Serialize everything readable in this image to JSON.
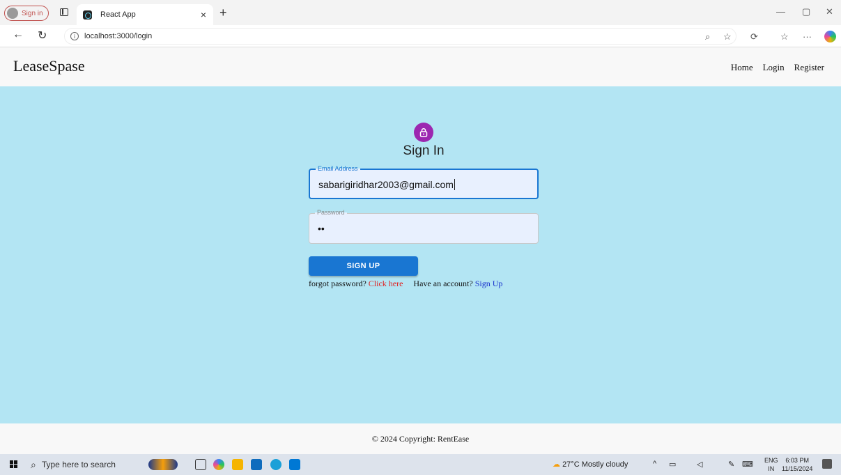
{
  "browser": {
    "profile_label": "Sign in",
    "tab_title": "React App",
    "url": "localhost:3000/login"
  },
  "header": {
    "brand": "LeaseSpase",
    "nav": [
      "Home",
      "Login",
      "Register"
    ]
  },
  "form": {
    "title": "Sign In",
    "email_label": "Email Address",
    "email_value": "sabarigiridhar2003@gmail.com",
    "password_label": "Password",
    "password_value": "••",
    "submit_label": "SIGN UP",
    "forgot_text": "forgot password?",
    "forgot_link": "Click here",
    "account_text": "Have an account?",
    "account_link": "Sign Up"
  },
  "footer": {
    "copyright": "© 2024 Copyright: RentEase"
  },
  "taskbar": {
    "search_placeholder": "Type here to search",
    "weather": "27°C  Mostly cloudy",
    "lang_top": "ENG",
    "lang_bottom": "IN",
    "time": "6:03 PM",
    "date": "11/15/2024"
  },
  "colors": {
    "main_bg": "#b3e5f3",
    "primary": "#1976d2",
    "avatar": "#9c27b0",
    "link_red": "#e02020",
    "link_blue": "#1a33cc"
  }
}
